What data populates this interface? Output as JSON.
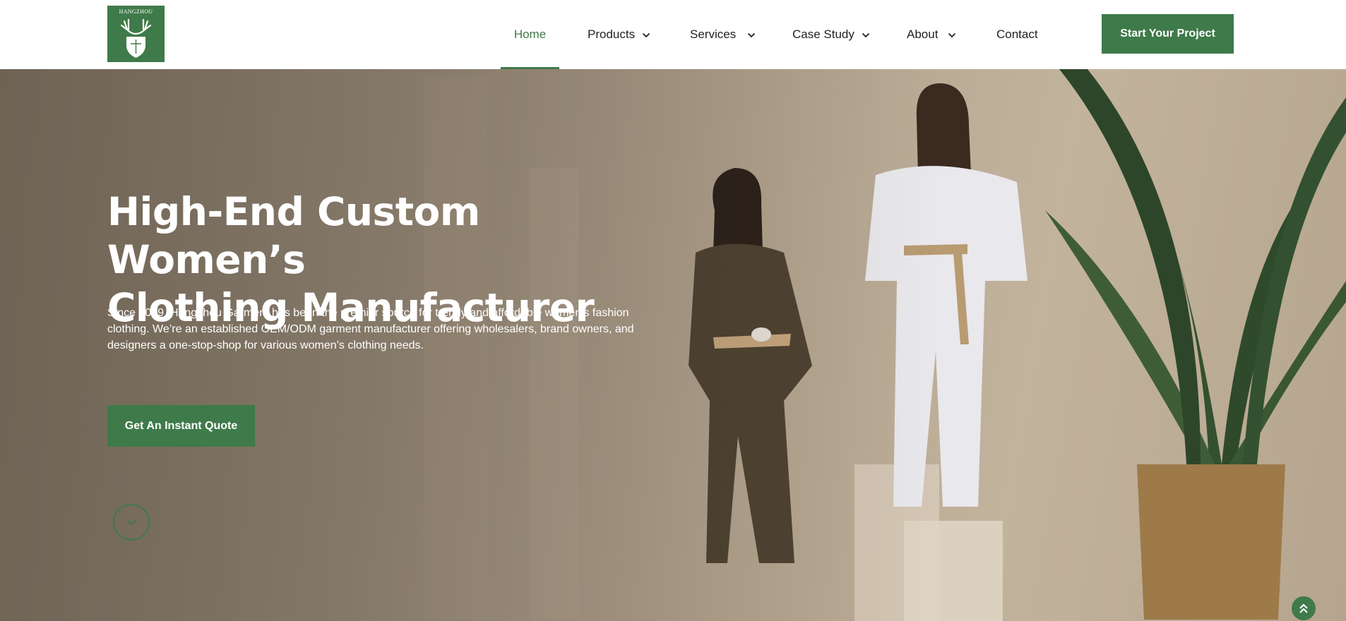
{
  "brand": {
    "logo_text": "HANGZHOU",
    "primary_color": "#3f7a4a"
  },
  "nav": {
    "items": [
      {
        "label": "Home",
        "active": true,
        "has_dropdown": false
      },
      {
        "label": "Products",
        "active": false,
        "has_dropdown": true
      },
      {
        "label": "Services",
        "active": false,
        "has_dropdown": true
      },
      {
        "label": "Case Study",
        "active": false,
        "has_dropdown": true
      },
      {
        "label": "About",
        "active": false,
        "has_dropdown": true
      },
      {
        "label": "Contact",
        "active": false,
        "has_dropdown": false
      }
    ],
    "cta_label": "Start Your Project"
  },
  "hero": {
    "title_line1": "High-End Custom Women’s",
    "title_line2": "Clothing Manufacturer",
    "description": "Since 2009, Hangzhou Garment has been the premier source for trendy and affordable women’s fashion clothing. We’re an established OEM/ODM garment manufacturer offering wholesalers, brand owners, and designers a one-stop-shop for various women’s clothing needs.",
    "cta_label": "Get An Instant Quote"
  },
  "icons": {
    "scroll_down": "chevron-down-icon",
    "back_to_top": "double-chevron-up-icon",
    "dropdown": "chevron-down-icon"
  }
}
